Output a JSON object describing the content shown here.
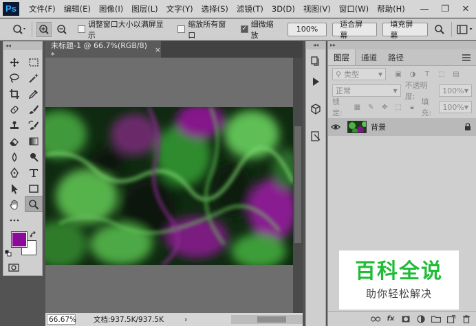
{
  "app": {
    "logo": "Ps",
    "menu": [
      "文件(F)",
      "编辑(E)",
      "图像(I)",
      "图层(L)",
      "文字(Y)",
      "选择(S)",
      "滤镜(T)",
      "3D(D)",
      "视图(V)",
      "窗口(W)",
      "帮助(H)"
    ],
    "window_controls": [
      "—",
      "❐",
      "✕"
    ]
  },
  "options_bar": {
    "resize_windows": "调整窗口大小以满屏显示",
    "zoom_all_windows": "缩放所有窗口",
    "scrubby_zoom": "细微缩放",
    "zoom_value": "100%",
    "fit_screen": "适合屏幕",
    "fill_screen": "填充屏幕"
  },
  "colors": {
    "foreground": "#8b0a97",
    "background": "#ffffff"
  },
  "document": {
    "tab_title": "未标题-1 @ 66.7%(RGB/8) *",
    "tab_close": "×",
    "zoom": "66.67%",
    "doc_info": "文档:937.5K/937.5K",
    "status_arrow": "›"
  },
  "layers_panel": {
    "tabs": [
      "图层",
      "通道",
      "路径"
    ],
    "filter_type": "类型",
    "blend_mode": "正常",
    "opacity_label": "不透明度:",
    "opacity_value": "100%",
    "lock_label": "锁定:",
    "fill_label": "填充:",
    "fill_value": "100%",
    "layer_name": "背景",
    "footer_icons": [
      "link-icon",
      "fx-icon",
      "mask-icon",
      "adjustment-icon",
      "group-icon",
      "new-layer-icon",
      "trash-icon"
    ],
    "fx_label": "fx"
  },
  "watermark": {
    "title": "百科全说",
    "subtitle": "助你轻松解决"
  }
}
